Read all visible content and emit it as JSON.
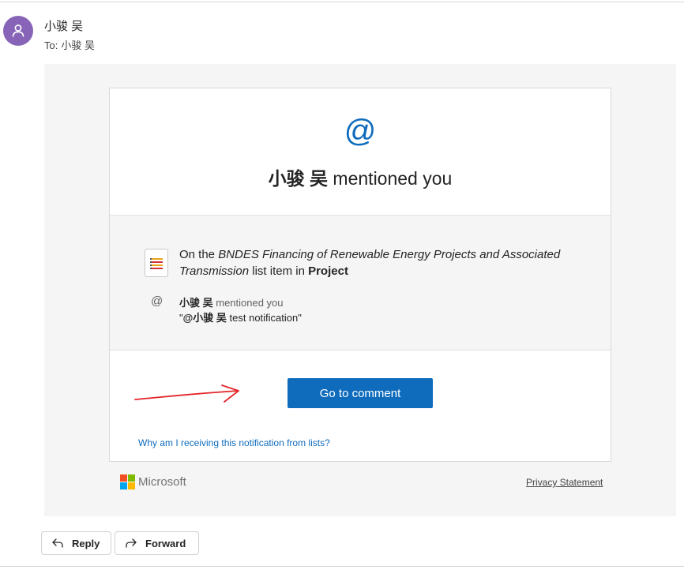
{
  "header": {
    "sender_name": "小骏 吴",
    "to_label": "To:",
    "to_name": "小骏 吴"
  },
  "card": {
    "at_symbol": "@",
    "headline_name": "小骏 吴",
    "headline_suffix": " mentioned you",
    "context": {
      "prefix": "On the ",
      "item_title": "BNDES Financing of Renewable Energy Projects and Associated Transmission",
      "middle": " list item in ",
      "list_name": "Project"
    },
    "mention": {
      "at_symbol": "@",
      "name": "小骏 吴",
      "verb": " mentioned you",
      "quote_open": "\"",
      "at_name": "@小骏 吴",
      "comment": " test notification",
      "quote_close": "\""
    },
    "cta_label": "Go to comment",
    "why_link": "Why am I receiving this notification from lists?"
  },
  "footer": {
    "brand": "Microsoft",
    "privacy_link": "Privacy Statement",
    "logo_colors": [
      "#f25022",
      "#7fba00",
      "#00a4ef",
      "#ffb900"
    ]
  },
  "actions": {
    "reply_label": "Reply",
    "forward_label": "Forward"
  },
  "colors": {
    "avatar": "#8764b8",
    "accent": "#0f6cbd",
    "annotation_arrow": "#e3262a"
  }
}
